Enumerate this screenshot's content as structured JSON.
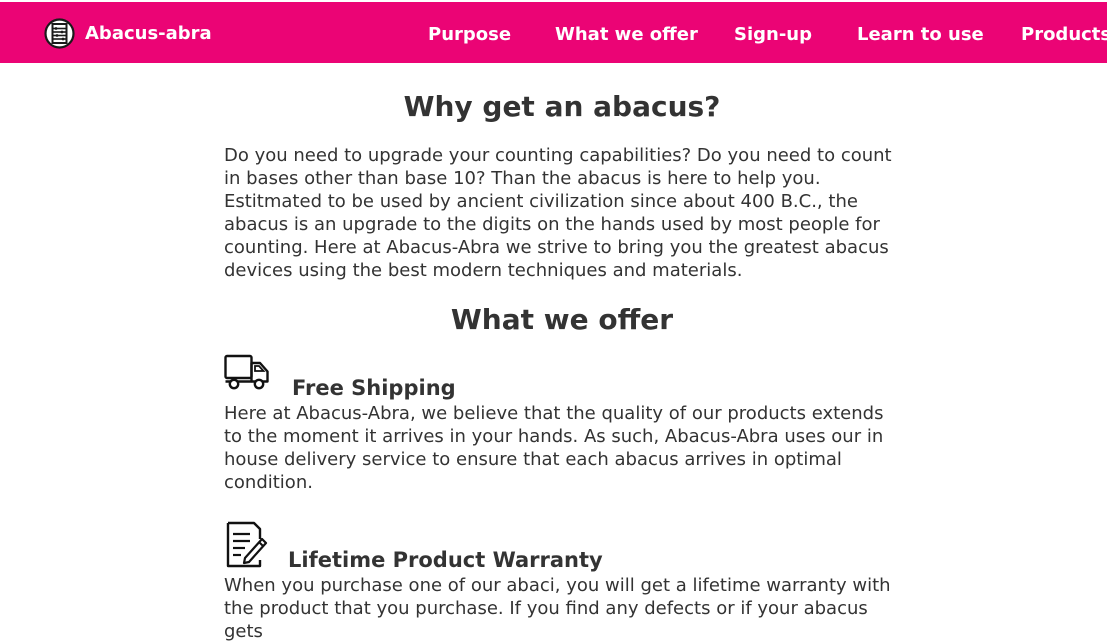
{
  "header": {
    "brand_name": "Abacus-abra",
    "logo_icon": "abacus-logo-icon",
    "background_color": "#eb0475",
    "nav": [
      {
        "label": "Purpose"
      },
      {
        "label": "What we offer"
      },
      {
        "label": "Sign-up"
      },
      {
        "label": "Learn to use"
      },
      {
        "label": "Products"
      }
    ]
  },
  "purpose": {
    "title": "Why get an abacus?",
    "body": "Do you need to upgrade your counting capabilities? Do you need to count in bases other than base 10? Than the abacus is here to help you. Estitmated to be used by ancient civilization since about 400 B.C., the abacus is an upgrade to the digits on the hands used by most people for counting. Here at Abacus-Abra we strive to bring you the greatest abacus devices using the best modern techniques and materials."
  },
  "offer": {
    "title": "What we offer",
    "items": [
      {
        "icon": "truck-icon",
        "title": "Free Shipping",
        "body": "Here at Abacus-Abra, we believe that the quality of our products extends to the moment it arrives in your hands. As such, Abacus-Abra uses our in house delivery service to ensure that each abacus arrives in optimal condition."
      },
      {
        "icon": "document-pen-icon",
        "title": "Lifetime Product Warranty",
        "body": "When you purchase one of our abaci, you will get a lifetime warranty with the product that you purchase. If you find any defects or if your abacus gets"
      }
    ]
  }
}
